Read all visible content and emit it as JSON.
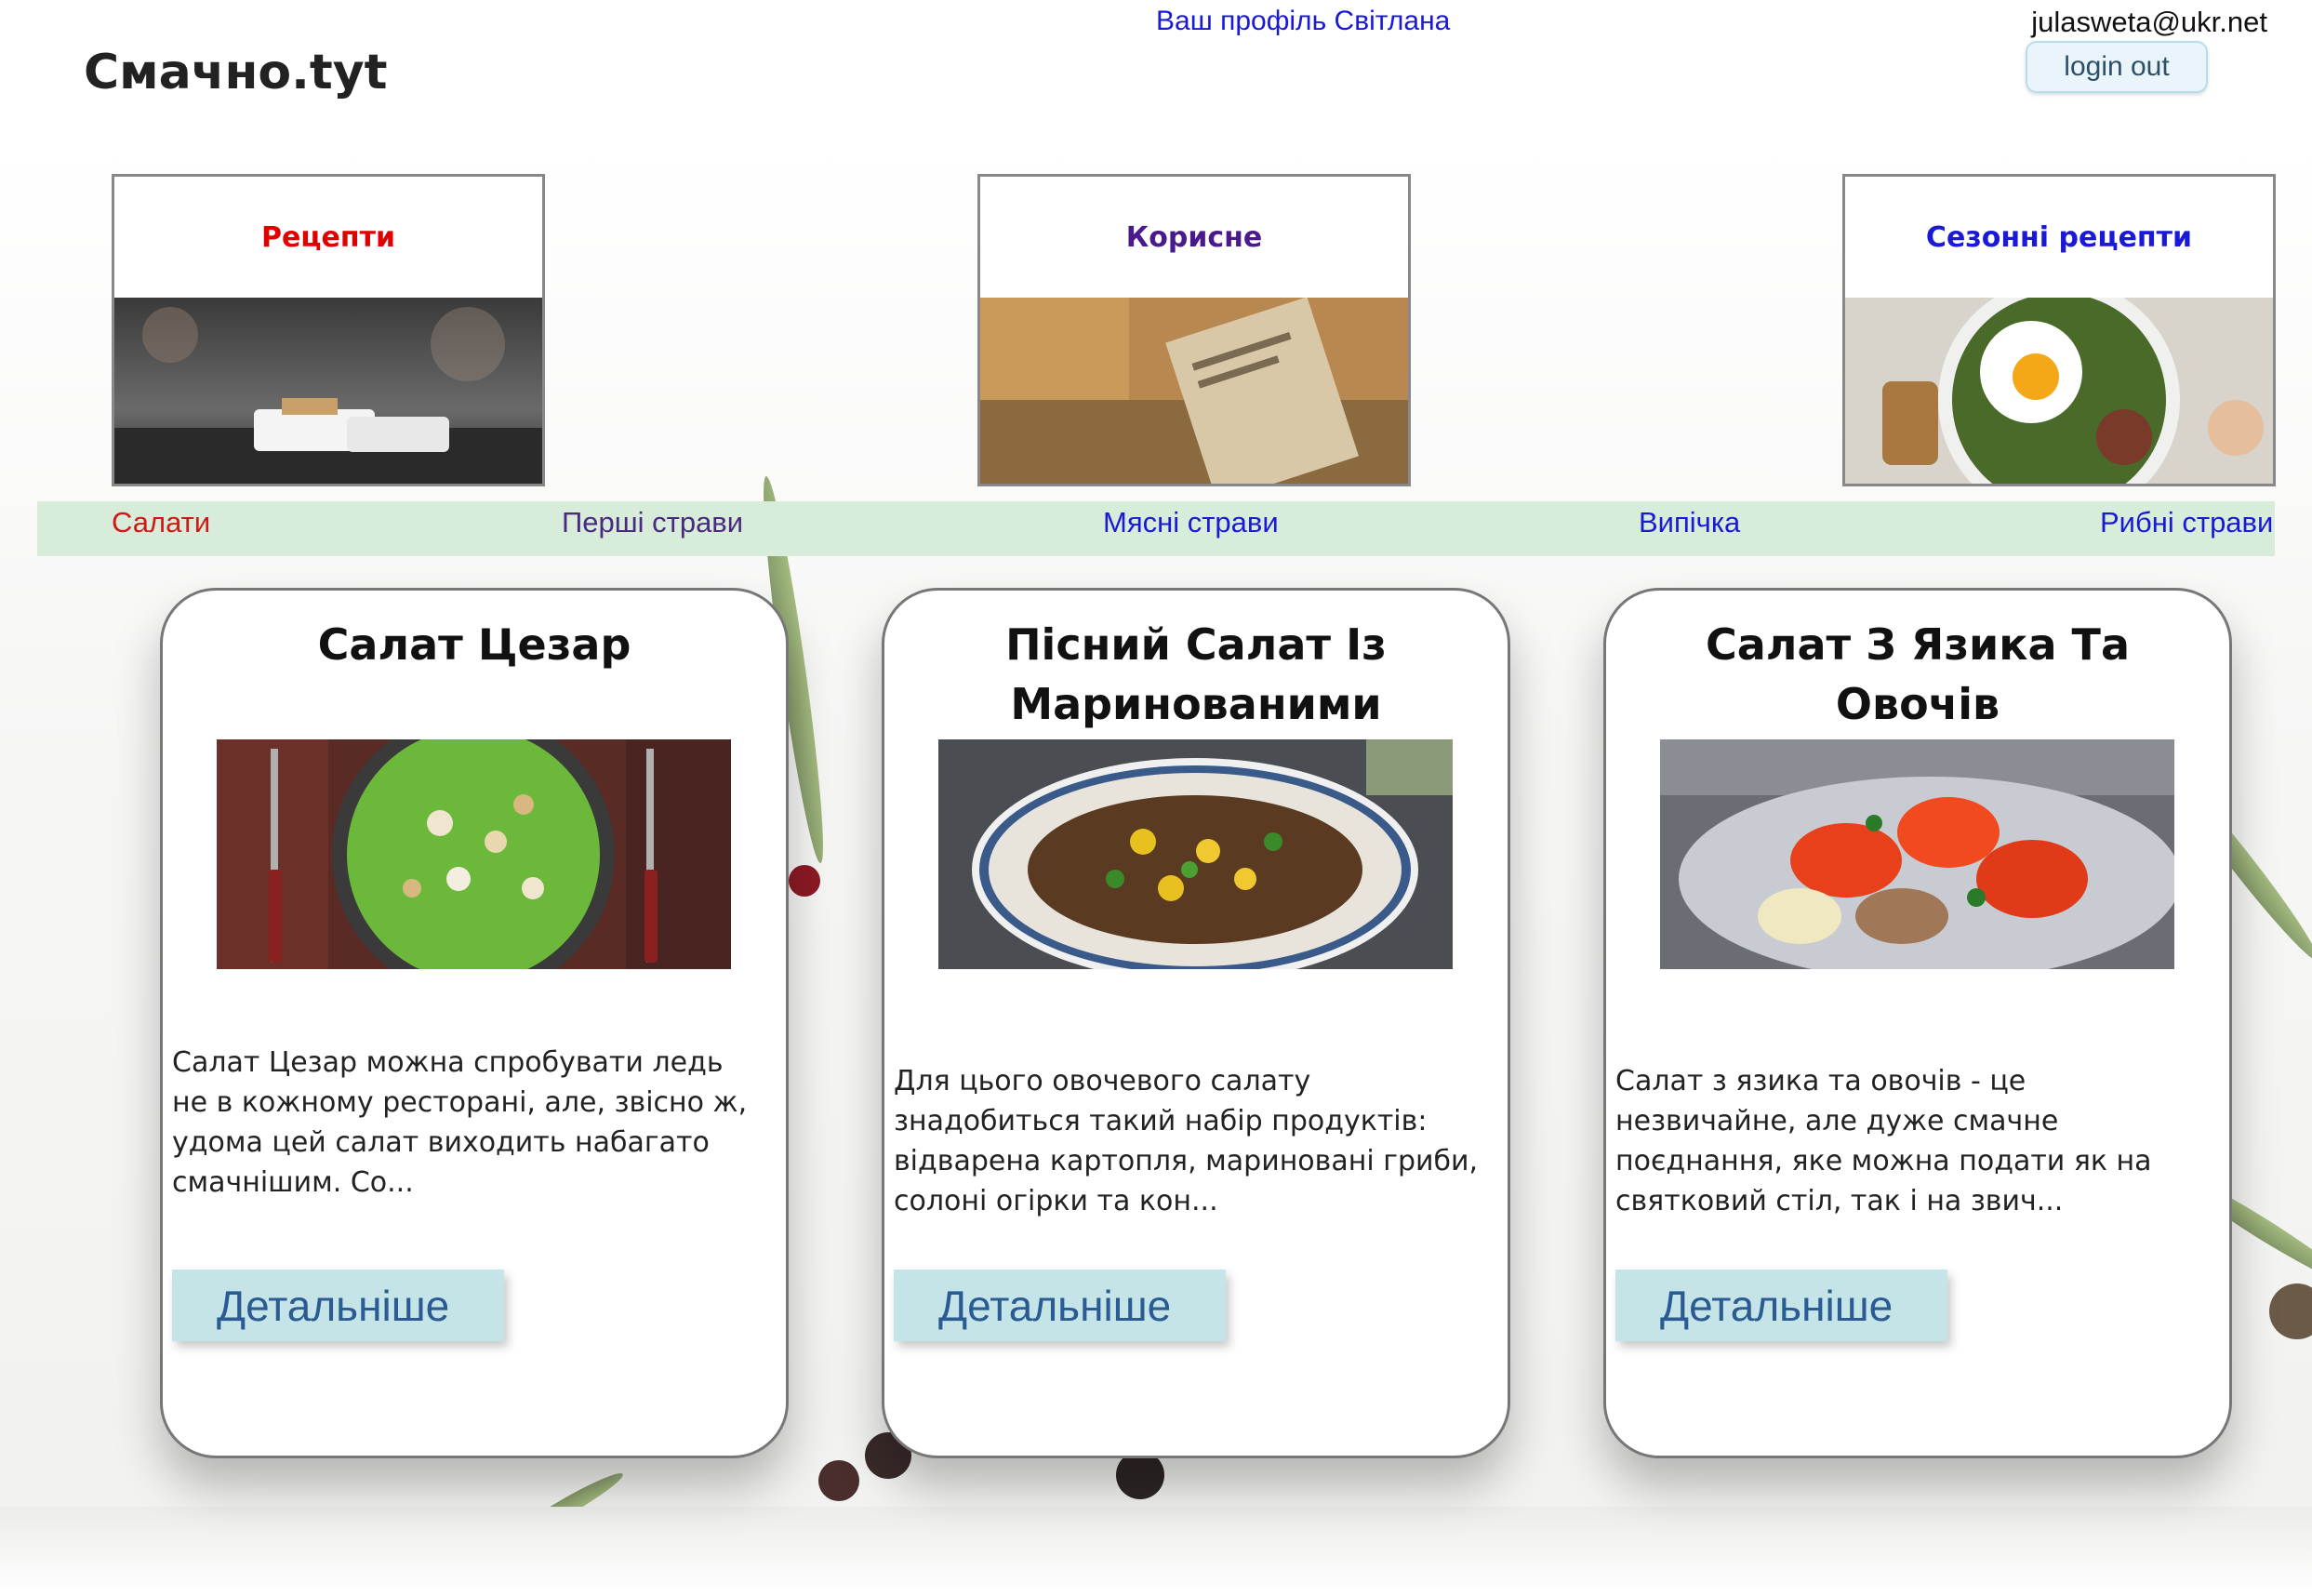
{
  "header": {
    "logo": "Смачно.tyt",
    "profile_link": "Ваш профіль Світлана",
    "email": "julasweta@ukr.net",
    "logout_label": "login out"
  },
  "categories": [
    {
      "title": "Рецепти",
      "color": "#e00000"
    },
    {
      "title": "Корисне",
      "color": "#4a1a8c"
    },
    {
      "title": "Сезонні рецепти",
      "color": "#1a1ad6"
    }
  ],
  "nav": [
    {
      "label": "Салати",
      "color": "#d01818"
    },
    {
      "label": "Перші страви",
      "color": "#4a2a80"
    },
    {
      "label": "Мясні страви",
      "color": "#1a1ad6"
    },
    {
      "label": "Випічка",
      "color": "#1a1ad6"
    },
    {
      "label": "Рибні страви",
      "color": "#1a1ad6"
    }
  ],
  "recipes": [
    {
      "title": "Салат Цезар",
      "description": "Салат Цезар можна спробувати ледь не в кожному ресторані, але, звісно ж, удома цей салат виходить набагато смачнішим. Со...",
      "button_label": "Детальніше"
    },
    {
      "title": "Пісний Салат Із Маринованими",
      "description": "Для цього овочевого салату знадобиться такий набір продуктів: відварена картопля, мариновані гриби, солоні огірки та кон...",
      "button_label": "Детальніше"
    },
    {
      "title": "Салат З Язика Та Овочів",
      "description": "Салат з язика та овочів - це незвичайне, але дуже смачне поєднання, яке можна подати як на святковий стіл, так і на звич...",
      "button_label": "Детальніше"
    }
  ],
  "colors": {
    "nav_bg": "#d7ecd9",
    "button_bg": "#c5e4e8",
    "button_text": "#2a5b92"
  }
}
